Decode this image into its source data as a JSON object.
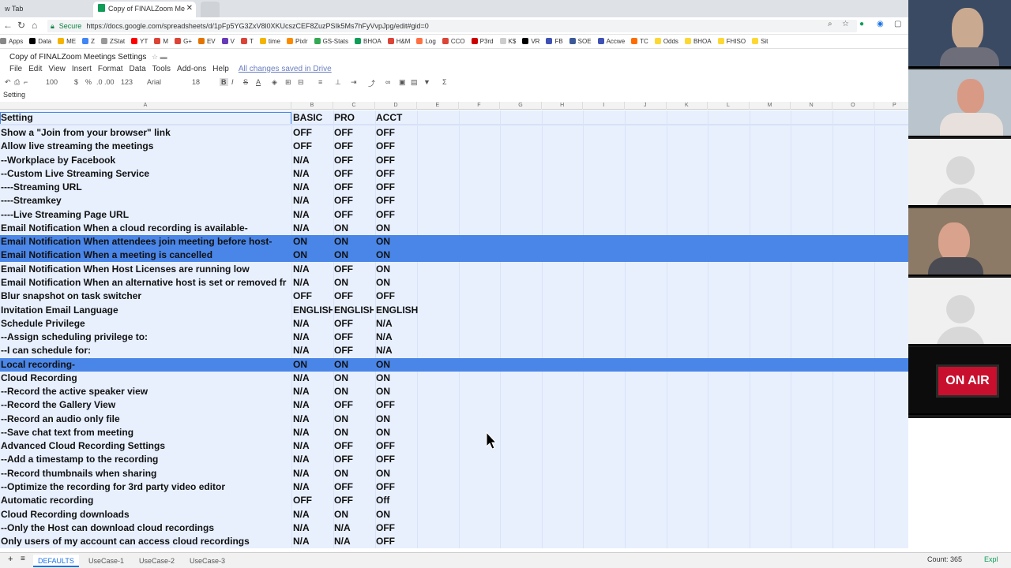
{
  "browser": {
    "tab1_title": "w Tab",
    "tab2_title": "Copy of FINALZoom Me",
    "secure_label": "Secure",
    "url": "https://docs.google.com/spreadsheets/d/1pFp5YG3ZxV8l0XKUcszCEF8ZuzPSIk5Ms7hFyVvpJpg/edit#gid=0",
    "bookmarks": [
      "Apps",
      "Data",
      "ME",
      "Z",
      "ZStat",
      "YT",
      "M",
      "G+",
      "EV",
      "V",
      "T",
      "time",
      "Pixlr",
      "GS-Stats",
      "BHOA",
      "H&M",
      "Log",
      "CCO",
      "P3rd",
      "K$",
      "VR",
      "FB",
      "SOE",
      "Accwe",
      "TC",
      "Odds",
      "BHOA",
      "FHISO",
      "Sit"
    ]
  },
  "sheets": {
    "doc_title": "Copy of FINALZoom Meetings Settings",
    "menus": [
      "File",
      "Edit",
      "View",
      "Insert",
      "Format",
      "Data",
      "Tools",
      "Add-ons",
      "Help"
    ],
    "saved_status": "All changes saved in Drive",
    "zoom": "100",
    "format_currency": "$",
    "format_percent": "%",
    "format_decimals": ".0 .00",
    "format_more": "123",
    "font": "Arial",
    "font_size": "18",
    "formula_bar": "Setting",
    "column_letters": [
      "A",
      "B",
      "C",
      "D",
      "E",
      "F",
      "G",
      "H",
      "I",
      "J",
      "K",
      "L",
      "M",
      "N",
      "O",
      "P"
    ]
  },
  "table": {
    "headers": [
      "Setting",
      "BASIC",
      "PRO",
      "ACCT"
    ],
    "rows": [
      {
        "setting": "Show a \"Join from your browser\" link",
        "basic": "OFF",
        "pro": "OFF",
        "acct": "OFF",
        "selected": false
      },
      {
        "setting": "Allow live streaming the meetings",
        "basic": "OFF",
        "pro": "OFF",
        "acct": "OFF",
        "selected": false
      },
      {
        "setting": "--Workplace by Facebook",
        "basic": "N/A",
        "pro": "OFF",
        "acct": "OFF",
        "selected": false
      },
      {
        "setting": "--Custom Live Streaming Service",
        "basic": "N/A",
        "pro": "OFF",
        "acct": "OFF",
        "selected": false
      },
      {
        "setting": "----Streaming URL",
        "basic": "N/A",
        "pro": "OFF",
        "acct": "OFF",
        "selected": false
      },
      {
        "setting": "----Streamkey",
        "basic": "N/A",
        "pro": "OFF",
        "acct": "OFF",
        "selected": false
      },
      {
        "setting": "----Live Streaming Page URL",
        "basic": "N/A",
        "pro": "OFF",
        "acct": "OFF",
        "selected": false
      },
      {
        "setting": "Email Notification When a cloud recording is available-",
        "basic": "N/A",
        "pro": "ON",
        "acct": "ON",
        "selected": false
      },
      {
        "setting": "Email Notification When attendees join meeting before host-",
        "basic": "ON",
        "pro": "ON",
        "acct": "ON",
        "selected": true
      },
      {
        "setting": "Email Notification When a meeting is cancelled",
        "basic": "ON",
        "pro": "ON",
        "acct": "ON",
        "selected": true
      },
      {
        "setting": "Email Notification When Host Licenses are running low",
        "basic": "N/A",
        "pro": "OFF",
        "acct": "ON",
        "selected": false
      },
      {
        "setting": "Email Notification When an alternative host is set or removed fr",
        "basic": "N/A",
        "pro": "ON",
        "acct": "ON",
        "selected": false
      },
      {
        "setting": "Blur snapshot on task switcher",
        "basic": "OFF",
        "pro": "OFF",
        "acct": "OFF",
        "selected": false
      },
      {
        "setting": "Invitation Email Language",
        "basic": "ENGLISH",
        "pro": "ENGLISH",
        "acct": "ENGLISH",
        "selected": false
      },
      {
        "setting": "Schedule Privilege",
        "basic": "N/A",
        "pro": "OFF",
        "acct": "N/A",
        "selected": false
      },
      {
        "setting": "--Assign scheduling privilege to:",
        "basic": "N/A",
        "pro": "OFF",
        "acct": "N/A",
        "selected": false
      },
      {
        "setting": "--I can schedule for:",
        "basic": "N/A",
        "pro": "OFF",
        "acct": "N/A",
        "selected": false
      },
      {
        "setting": "Local recording-",
        "basic": "ON",
        "pro": "ON",
        "acct": "ON",
        "selected": true
      },
      {
        "setting": "Cloud Recording",
        "basic": "N/A",
        "pro": "ON",
        "acct": "ON",
        "selected": false
      },
      {
        "setting": "--Record the active speaker view",
        "basic": "N/A",
        "pro": "ON",
        "acct": "ON",
        "selected": false
      },
      {
        "setting": "--Record the Gallery View",
        "basic": "N/A",
        "pro": "OFF",
        "acct": "OFF",
        "selected": false
      },
      {
        "setting": "--Record an audio only file",
        "basic": "N/A",
        "pro": "ON",
        "acct": "ON",
        "selected": false
      },
      {
        "setting": "--Save chat text from meeting",
        "basic": "N/A",
        "pro": "ON",
        "acct": "ON",
        "selected": false
      },
      {
        "setting": "Advanced Cloud Recording Settings",
        "basic": "N/A",
        "pro": "OFF",
        "acct": "OFF",
        "selected": false
      },
      {
        "setting": "--Add a timestamp to the recording",
        "basic": "N/A",
        "pro": "OFF",
        "acct": "OFF",
        "selected": false
      },
      {
        "setting": "--Record thumbnails when sharing",
        "basic": "N/A",
        "pro": "ON",
        "acct": "ON",
        "selected": false
      },
      {
        "setting": "--Optimize the recording for 3rd party video editor",
        "basic": "N/A",
        "pro": "OFF",
        "acct": "OFF",
        "selected": false
      },
      {
        "setting": "Automatic recording",
        "basic": "OFF",
        "pro": "OFF",
        "acct": "Off",
        "selected": false
      },
      {
        "setting": "Cloud Recording downloads",
        "basic": "N/A",
        "pro": "ON",
        "acct": "ON",
        "selected": false
      },
      {
        "setting": "--Only the Host can download cloud recordings",
        "basic": "N/A",
        "pro": "N/A",
        "acct": "OFF",
        "selected": false
      },
      {
        "setting": "Only users of my account can access cloud recordings",
        "basic": "N/A",
        "pro": "N/A",
        "acct": "OFF",
        "selected": false
      }
    ]
  },
  "bottom": {
    "sheet_tabs": [
      "DEFAULTS",
      "UseCase-1",
      "UseCase-2",
      "UseCase-3"
    ],
    "count": "Count: 365",
    "explore": "Expl"
  },
  "video": {
    "on_air": "ON AIR"
  },
  "colors": {
    "selection": "#4a86e8",
    "sheet_bg": "#e8f0fe",
    "brand_green": "#0f9d58"
  }
}
